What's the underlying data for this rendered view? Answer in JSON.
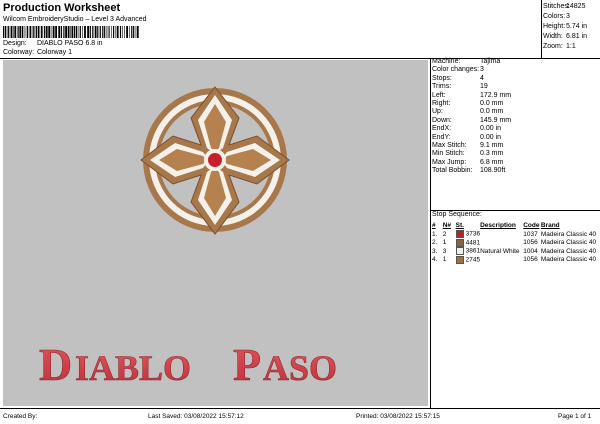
{
  "header": {
    "title": "Production Worksheet",
    "subtitle": "Wilcom EmbroideryStudio – Level 3 Advanced",
    "design_label": "Design:",
    "design_value": "DIABLO PASO 6.8 in",
    "colorway_label": "Colorway:",
    "colorway_value": "Colorway 1"
  },
  "stats": [
    {
      "label": "Stitches:",
      "value": "14825"
    },
    {
      "label": "Colors:",
      "value": "3"
    },
    {
      "label": "Height:",
      "value": "5.74 in"
    },
    {
      "label": "Width:",
      "value": "6.81 in"
    },
    {
      "label": "Zoom:",
      "value": "1:1"
    }
  ],
  "design_art": {
    "text": "Diablo Paso",
    "text_color": "#d9464e",
    "cross_brown": "#a8774a",
    "cross_white": "#f4f1ea",
    "center_red": "#c8202a"
  },
  "details": [
    {
      "label": "Machine:",
      "value": "Tajima"
    },
    {
      "label": "Color changes:",
      "value": "3"
    },
    {
      "label": "Stops:",
      "value": "4"
    },
    {
      "label": "Trims:",
      "value": "19"
    },
    {
      "label": "Left:",
      "value": "172.9 mm"
    },
    {
      "label": "Right:",
      "value": "0.0 mm"
    },
    {
      "label": "Up:",
      "value": "0.0 mm"
    },
    {
      "label": "Down:",
      "value": "145.9 mm"
    },
    {
      "label": "EndX:",
      "value": "0.00 in"
    },
    {
      "label": "EndY:",
      "value": "0.00 in"
    },
    {
      "label": "Max Stitch:",
      "value": "9.1 mm"
    },
    {
      "label": "Min Stitch:",
      "value": "0.3 mm"
    },
    {
      "label": "Max Jump:",
      "value": "6.8 mm"
    },
    {
      "label": "Total Bobbin:",
      "value": "108.90ft"
    }
  ],
  "sequence": {
    "title": "Stop Sequence:",
    "columns": [
      "#",
      "N#",
      "St.",
      "Description",
      "Code",
      "Brand"
    ],
    "rows": [
      {
        "num": "1.",
        "n": "2",
        "color": "#b0232a",
        "st": "3736",
        "desc": "",
        "code": "1037",
        "brand": "Madeira Classic 40"
      },
      {
        "num": "2.",
        "n": "1",
        "color": "#8a6240",
        "st": "4481",
        "desc": "",
        "code": "1056",
        "brand": "Madeira Classic 40"
      },
      {
        "num": "3.",
        "n": "3",
        "color": "#f2f0ea",
        "st": "3861",
        "desc": "Natural White",
        "code": "1004",
        "brand": "Madeira Classic 40"
      },
      {
        "num": "4.",
        "n": "1",
        "color": "#a0703f",
        "st": "2745",
        "desc": "",
        "code": "1056",
        "brand": "Madeira Classic 40"
      }
    ]
  },
  "footer": {
    "created": "Created By:",
    "saved": "Last Saved: 03/08/2022 15:57:12",
    "printed": "Printed: 03/08/2022 15:57:15",
    "page": "Page 1 of 1"
  }
}
